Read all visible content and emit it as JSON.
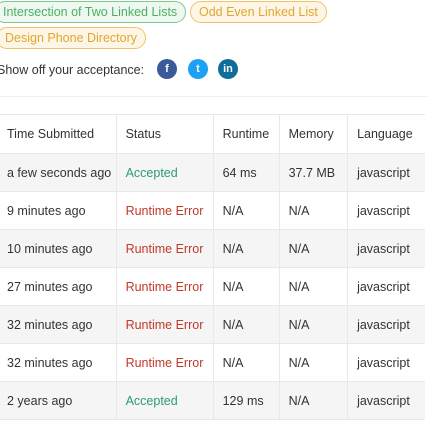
{
  "tags": [
    {
      "label": "Intersection of Two Linked Lists",
      "color": "green"
    },
    {
      "label": "Odd Even Linked List",
      "color": "orange"
    },
    {
      "label": "Design Phone Directory",
      "color": "orange"
    }
  ],
  "share": {
    "label": "Show off your acceptance:",
    "icons": [
      {
        "name": "facebook-icon",
        "glyph": "f"
      },
      {
        "name": "twitter-icon",
        "glyph": "t"
      },
      {
        "name": "linkedin-icon",
        "glyph": "in"
      }
    ]
  },
  "table": {
    "headers": [
      "Time Submitted",
      "Status",
      "Runtime",
      "Memory",
      "Language"
    ],
    "rows": [
      {
        "time": "a few seconds ago",
        "status": "Accepted",
        "runtime": "64 ms",
        "memory": "37.7 MB",
        "language": "javascript"
      },
      {
        "time": "9 minutes ago",
        "status": "Runtime Error",
        "runtime": "N/A",
        "memory": "N/A",
        "language": "javascript"
      },
      {
        "time": "10 minutes ago",
        "status": "Runtime Error",
        "runtime": "N/A",
        "memory": "N/A",
        "language": "javascript"
      },
      {
        "time": "27 minutes ago",
        "status": "Runtime Error",
        "runtime": "N/A",
        "memory": "N/A",
        "language": "javascript"
      },
      {
        "time": "32 minutes ago",
        "status": "Runtime Error",
        "runtime": "N/A",
        "memory": "N/A",
        "language": "javascript"
      },
      {
        "time": "32 minutes ago",
        "status": "Runtime Error",
        "runtime": "N/A",
        "memory": "N/A",
        "language": "javascript"
      },
      {
        "time": "2 years ago",
        "status": "Accepted",
        "runtime": "129 ms",
        "memory": "N/A",
        "language": "javascript"
      }
    ]
  },
  "colors": {
    "accepted": "#2c9a76",
    "runtime_error": "#c0392b",
    "tag_green": "#4caf63",
    "tag_orange": "#e0a72e"
  }
}
